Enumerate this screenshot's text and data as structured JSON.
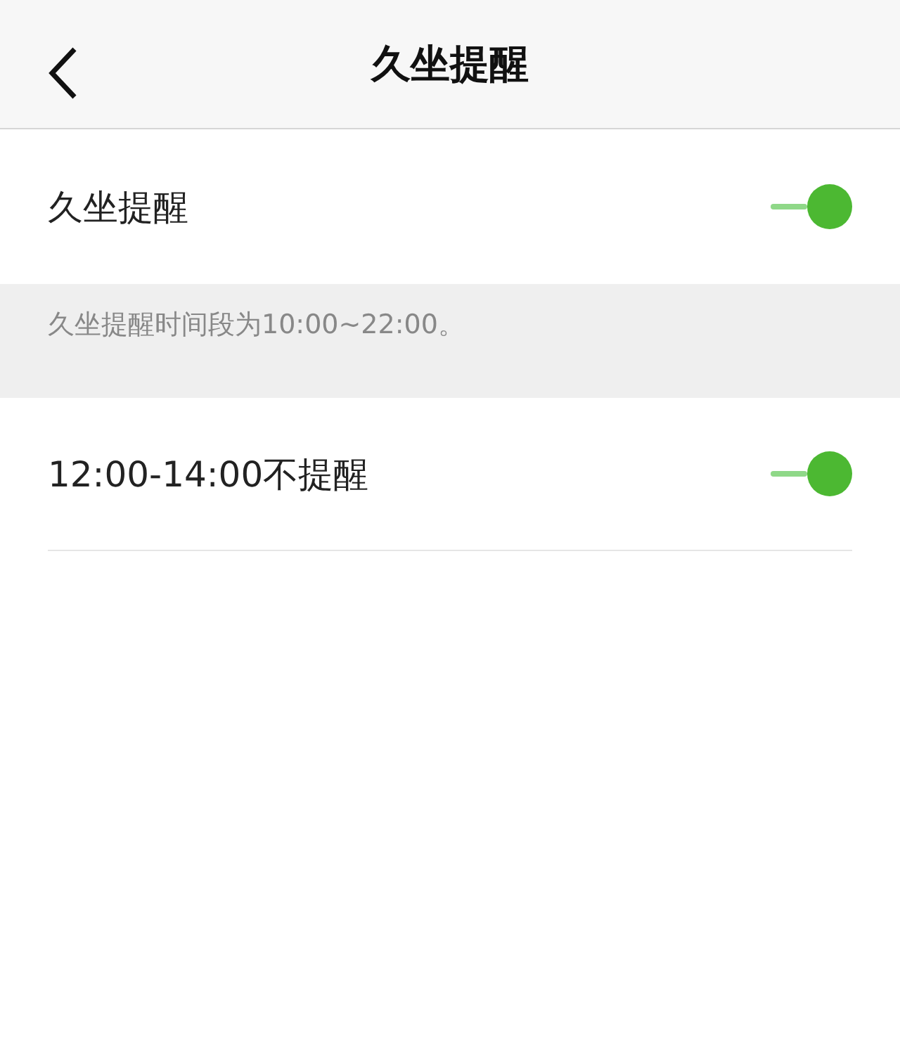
{
  "header": {
    "title": "久坐提醒"
  },
  "settings": [
    {
      "kind": "toggle",
      "label": "久坐提醒",
      "on": true
    },
    {
      "kind": "note",
      "text": "久坐提醒时间段为10:00~22:00。"
    },
    {
      "kind": "toggle",
      "label": "12:00-14:00不提醒",
      "on": true
    }
  ]
}
